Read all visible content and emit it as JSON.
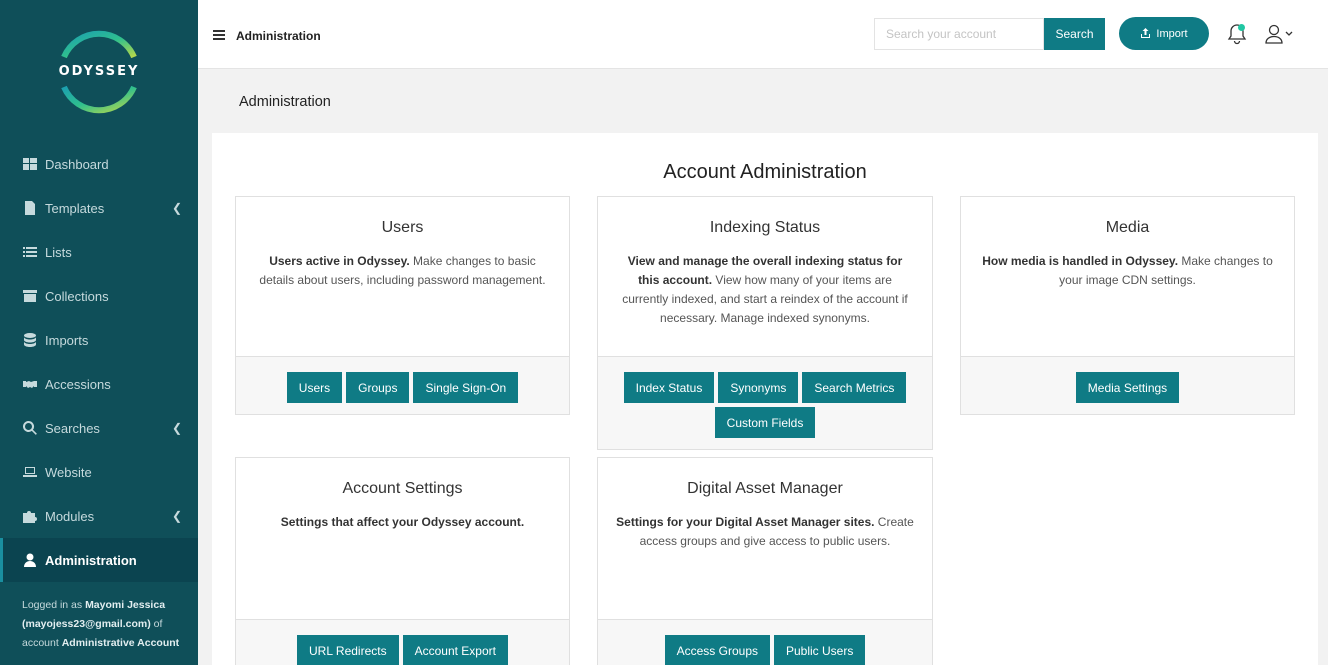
{
  "brand": {
    "name": "ODYSSEY"
  },
  "colors": {
    "sidebar": "#0f4f59",
    "accent": "#0f7b85",
    "notification_dot": "#21c7a3"
  },
  "sidebar": {
    "items": [
      {
        "label": "Dashboard",
        "icon": "dashboard-icon",
        "has_chevron": false
      },
      {
        "label": "Templates",
        "icon": "file-icon",
        "has_chevron": true
      },
      {
        "label": "Lists",
        "icon": "list-icon",
        "has_chevron": false
      },
      {
        "label": "Collections",
        "icon": "archive-icon",
        "has_chevron": false
      },
      {
        "label": "Imports",
        "icon": "database-icon",
        "has_chevron": false
      },
      {
        "label": "Accessions",
        "icon": "handshake-icon",
        "has_chevron": false
      },
      {
        "label": "Searches",
        "icon": "search-icon",
        "has_chevron": true
      },
      {
        "label": "Website",
        "icon": "laptop-icon",
        "has_chevron": false
      },
      {
        "label": "Modules",
        "icon": "puzzle-icon",
        "has_chevron": true
      },
      {
        "label": "Administration",
        "icon": "user-icon",
        "has_chevron": false,
        "active": true
      }
    ],
    "logged_in": {
      "prefix": "Logged in as",
      "name": "Mayomi Jessica",
      "email": "(mayojess23@gmail.com)",
      "mid": "of account",
      "account": "Administrative Account"
    }
  },
  "header": {
    "title": "Administration",
    "search_placeholder": "Search your account",
    "search_label": "Search",
    "import_label": "Import"
  },
  "main": {
    "page_title": "Administration",
    "heading": "Account Administration",
    "cards": [
      {
        "title": "Users",
        "desc_bold": "Users active in Odyssey.",
        "desc_rest": " Make changes to basic details about users, including password management.",
        "buttons": [
          "Users",
          "Groups",
          "Single Sign-On"
        ]
      },
      {
        "title": "Indexing Status",
        "desc_bold": "View and manage the overall indexing status for this account.",
        "desc_rest": " View how many of your items are currently indexed, and start a reindex of the account if necessary. Manage indexed synonyms.",
        "buttons": [
          "Index Status",
          "Synonyms",
          "Search Metrics",
          "Custom Fields"
        ]
      },
      {
        "title": "Media",
        "desc_bold": "How media is handled in Odyssey.",
        "desc_rest": " Make changes to your image CDN settings.",
        "buttons": [
          "Media Settings"
        ]
      },
      {
        "title": "Account Settings",
        "desc_bold": "Settings that affect your Odyssey account.",
        "desc_rest": "",
        "buttons": [
          "URL Redirects",
          "Account Export"
        ]
      },
      {
        "title": "Digital Asset Manager",
        "desc_bold": "Settings for your Digital Asset Manager sites.",
        "desc_rest": " Create access groups and give access to public users.",
        "buttons": [
          "Access Groups",
          "Public Users"
        ]
      }
    ]
  }
}
